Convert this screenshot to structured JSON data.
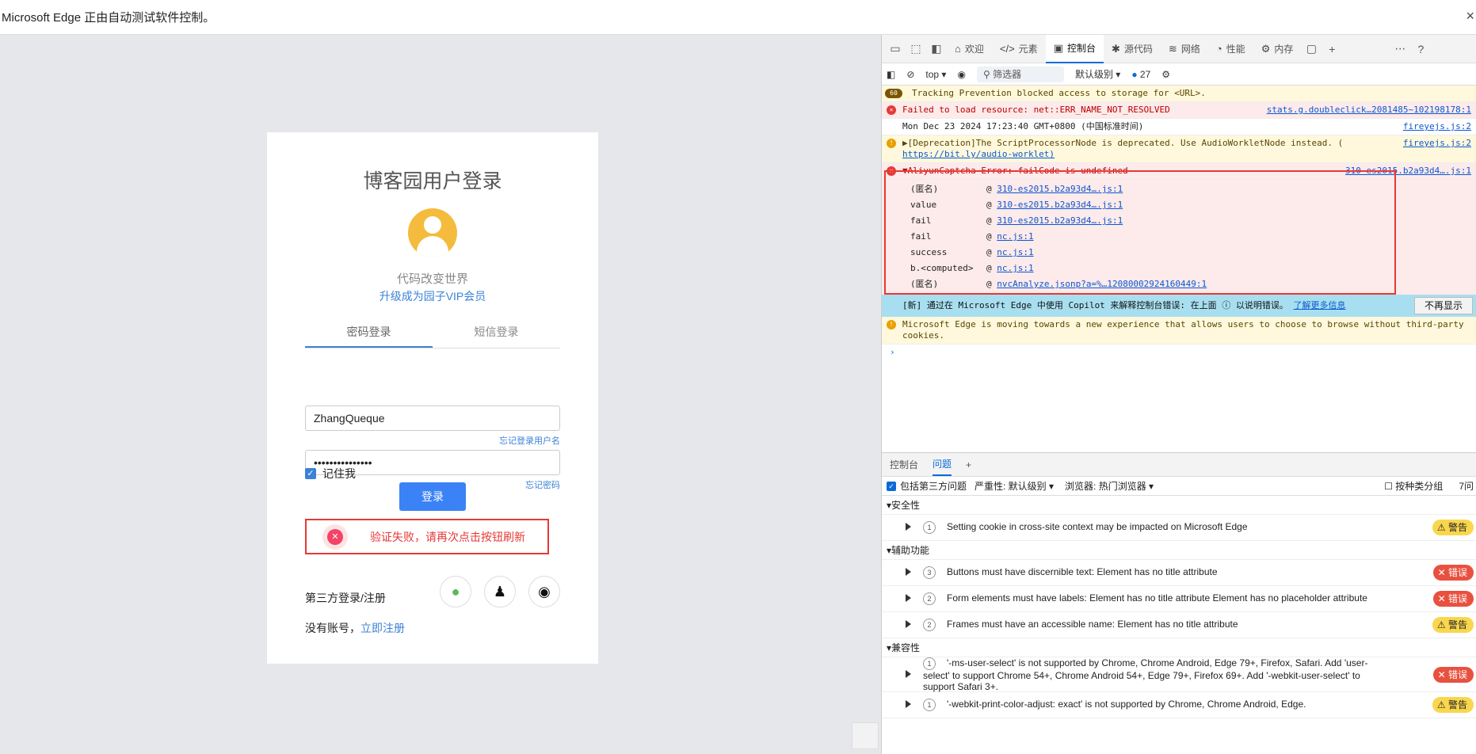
{
  "infobar": {
    "text": "Microsoft Edge 正由自动测试软件控制。",
    "close": "×"
  },
  "login": {
    "title": "博客园用户登录",
    "motto": "代码改变世界",
    "vip": "升级成为园子VIP会员",
    "tabs": [
      "密码登录",
      "短信登录"
    ],
    "username": "ZhangQueque",
    "forgot_user": "忘记登录用户名",
    "password": "•••••••••••••••",
    "forgot_pwd": "忘记密码",
    "remember": "记住我",
    "login_button": "登录",
    "captcha_msg": "验证失败，请再次点击按钮刷新",
    "third_party": "第三方登录/注册",
    "no_account": "没有账号，",
    "register": "立即注册"
  },
  "devtools": {
    "tabs": [
      "欢迎",
      "元素",
      "控制台",
      "源代码",
      "网络",
      "性能",
      "内存"
    ],
    "toolbar": {
      "context": "top",
      "filter": "筛选器",
      "level": "默认级别",
      "count": "27"
    },
    "console": [
      {
        "type": "warn",
        "badge": "60",
        "text": "Tracking Prevention blocked access to storage for <URL>.",
        "src": ""
      },
      {
        "type": "err",
        "text": "Failed to load resource: net::ERR_NAME_NOT_RESOLVED",
        "src": "stats.g.doubleclick…2081485~102198178:1"
      },
      {
        "type": "info",
        "text": "Mon Dec 23 2024 17:23:40 GMT+0800 (中国标准时间)",
        "src": "fireyejs.js:2"
      },
      {
        "type": "warn",
        "text": "▶[Deprecation]The ScriptProcessorNode is deprecated. Use AudioWorkletNode instead. (",
        "text2": "https://bit.ly/audio-worklet)",
        "src": "fireyejs.js:2"
      },
      {
        "type": "err",
        "text": "▼AliyunCaptcha Error: failCode is undefined",
        "src": "310-es2015.b2a93d4….js:1"
      }
    ],
    "stack": [
      {
        "fn": "(匿名)",
        "loc": "310-es2015.b2a93d4….js:1"
      },
      {
        "fn": "value",
        "loc": "310-es2015.b2a93d4….js:1"
      },
      {
        "fn": "fail",
        "loc": "310-es2015.b2a93d4….js:1"
      },
      {
        "fn": "fail",
        "loc": "nc.js:1"
      },
      {
        "fn": "success",
        "loc": "nc.js:1"
      },
      {
        "fn": "b.<computed>",
        "loc": "nc.js:1"
      },
      {
        "fn": "(匿名)",
        "loc": "nvcAnalyze.jsonp?a=%…12080002924160449:1"
      }
    ],
    "copilot": {
      "text": "[新] 通过在 Microsoft Edge 中使用 Copilot 来解释控制台错误: 在上面",
      "text2": "以说明错误。",
      "link": "了解更多信息",
      "dismiss": "不再显示"
    },
    "edge_warn": "Microsoft Edge is moving towards a new experience that allows users to choose to browse without third-party cookies.",
    "drawer": {
      "tabs": [
        "控制台",
        "问题"
      ],
      "bar": {
        "third": "包括第三方问题",
        "severity": "严重性: 默认级别",
        "browser": "浏览器: 热门浏览器",
        "group": "按种类分组",
        "right": "7问"
      },
      "categories": [
        {
          "name": "安全性",
          "issues": [
            {
              "count": "1",
              "text": "Setting cookie in cross-site context may be impacted on Microsoft Edge",
              "level": "w",
              "label": "警告"
            }
          ]
        },
        {
          "name": "辅助功能",
          "issues": [
            {
              "count": "3",
              "text": "Buttons must have discernible text: Element has no title attribute",
              "level": "e",
              "label": "错误"
            },
            {
              "count": "2",
              "text": "Form elements must have labels: Element has no title attribute Element has no placeholder attribute",
              "level": "e",
              "label": "错误"
            },
            {
              "count": "2",
              "text": "Frames must have an accessible name: Element has no title attribute",
              "level": "w",
              "label": "警告"
            }
          ]
        },
        {
          "name": "兼容性",
          "issues": [
            {
              "count": "1",
              "text": "'-ms-user-select' is not supported by Chrome, Chrome Android, Edge 79+, Firefox, Safari. Add 'user-select' to support Chrome 54+, Chrome Android 54+, Edge 79+, Firefox 69+. Add '-webkit-user-select' to support Safari 3+.",
              "level": "e",
              "label": "错误"
            },
            {
              "count": "1",
              "text": "'-webkit-print-color-adjust: exact' is not supported by Chrome, Chrome Android, Edge.",
              "level": "w",
              "label": "警告"
            }
          ]
        }
      ]
    }
  }
}
